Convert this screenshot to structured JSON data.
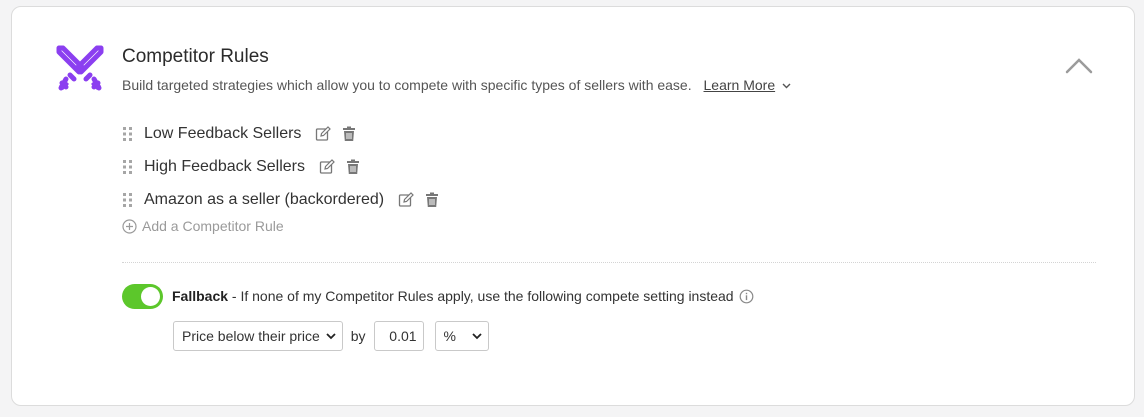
{
  "header": {
    "title": "Competitor Rules",
    "subtitle": "Build targeted strategies which allow you to compete with specific types of sellers with ease.",
    "learn_more": "Learn More",
    "logo_icon": "crossed-swords-icon",
    "collapse_icon": "chevron-up-icon"
  },
  "rules": [
    {
      "label": "Low Feedback Sellers"
    },
    {
      "label": "High Feedback Sellers"
    },
    {
      "label": "Amazon as a seller (backordered)"
    }
  ],
  "add_rule_label": "Add a Competitor Rule",
  "fallback": {
    "enabled": true,
    "title": "Fallback",
    "description": " - If none of my Competitor Rules apply, use the following compete setting instead",
    "strategy_selected": "Price below their price",
    "by_label": "by",
    "amount": "0.01",
    "unit_selected": "%"
  },
  "colors": {
    "accent_purple": "#8b3ff0",
    "toggle_green": "#5cc72b"
  }
}
